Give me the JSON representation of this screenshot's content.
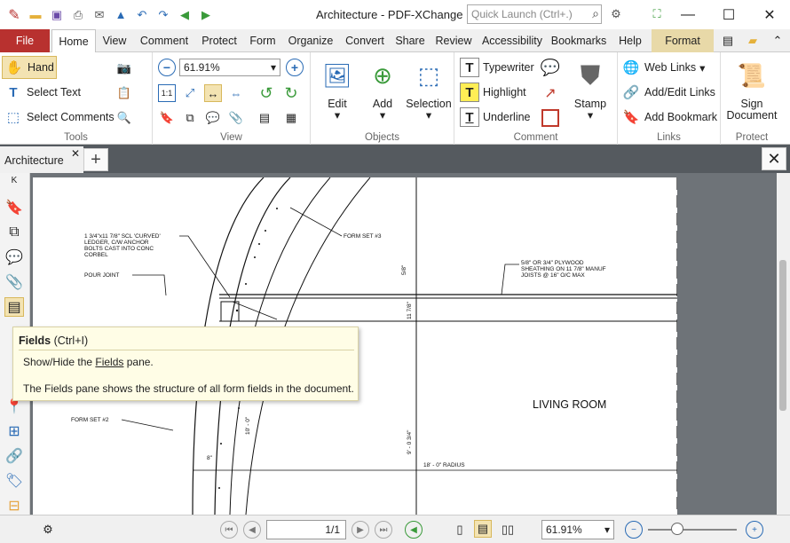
{
  "window": {
    "title": "Architecture - PDF-XChange E...",
    "quick_launch_placeholder": "Quick Launch (Ctrl+.)",
    "minimize": "—",
    "maximize": "☐",
    "close": "✕"
  },
  "menu": {
    "tabs": [
      "File",
      "Home",
      "View",
      "Comment",
      "Protect",
      "Form",
      "Organize",
      "Convert",
      "Share",
      "Review",
      "Accessibility",
      "Bookmarks",
      "Help",
      "Format"
    ]
  },
  "ribbon": {
    "tools": {
      "hand": "Hand",
      "select_text": "Select Text",
      "select_comments": "Select Comments",
      "label": "Tools"
    },
    "view": {
      "zoom": "61.91%",
      "label": "View"
    },
    "objects": {
      "edit": "Edit",
      "add": "Add",
      "selection": "Selection",
      "label": "Objects"
    },
    "comment": {
      "typewriter": "Typewriter",
      "highlight": "Highlight",
      "underline": "Underline",
      "stamp": "Stamp",
      "label": "Comment"
    },
    "links": {
      "web_links": "Web Links",
      "add_edit_links": "Add/Edit Links",
      "add_bookmark": "Add Bookmark",
      "label": "Links"
    },
    "protect": {
      "sign": "Sign",
      "document": "Document",
      "label": "Protect"
    }
  },
  "doc_tab": {
    "name": "Architecture"
  },
  "drawing": {
    "labels": [
      "1 3/4\"x11 7/8\" SCL 'CURVED'",
      "LEDGER, C/W ANCHOR",
      "BOLTS CAST INTO CONC",
      "CORBEL",
      "POUR JOINT",
      "FORM SET #3",
      "5/8\" OR 3/4\" PLYWOOD",
      "SHEATHING ON 11 7/8\" MANUF",
      "JOISTS @ 16\" O/C MAX",
      "5/8\"",
      "11 7/8\"",
      "LIVING ROOM",
      "FORM SET #2",
      "10' - 0\"",
      "9' - 0 3/4\"",
      "18' - 0\"  RADIUS",
      "8\""
    ]
  },
  "tooltip": {
    "title": "Fields",
    "shortcut": "(Ctrl+I)",
    "line1_prefix": "Show/Hide the ",
    "line1_link": "Fields",
    "line1_suffix": " pane.",
    "line2": "The Fields pane shows the structure of all form fields in the document."
  },
  "status": {
    "page": "1/1",
    "zoom": "61.91%"
  }
}
